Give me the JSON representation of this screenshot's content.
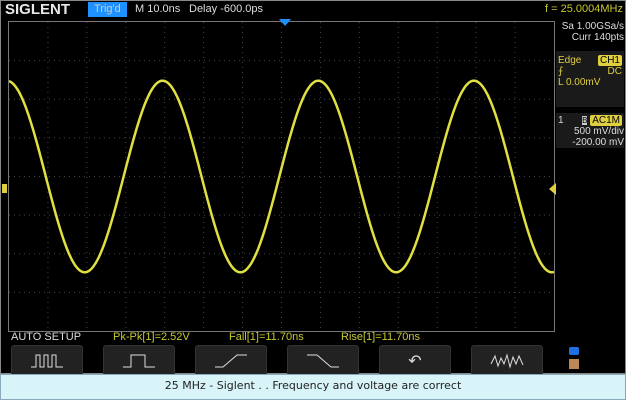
{
  "header": {
    "logo": "SIGLENT",
    "trigger_status": "Trig'd",
    "timebase": "M 10.0ns",
    "delay": "Delay -600.0ps",
    "frequency": "f = 25.0004MHz"
  },
  "acquisition": {
    "sample_rate": "Sa 1.00GSa/s",
    "memory": "Curr 140pts"
  },
  "trigger": {
    "type": "Edge",
    "source": "CH1",
    "coupling": "DC",
    "level": "L  0.00mV"
  },
  "channel": {
    "number": "1",
    "coupling": "AC1M",
    "scale": "500 mV/div",
    "offset": "-200.00 mV"
  },
  "measurements": {
    "auto_setup": "AUTO SETUP",
    "pkpk": "Pk-Pk[1]=2.52V",
    "fall": "Fall[1]=11.70ns",
    "rise": "Rise[1]=11.70ns"
  },
  "buttons": [
    "multi-period",
    "single-period",
    "rising-edge",
    "falling-edge",
    "undo",
    "random"
  ],
  "caption": "25 MHz - Siglent . . Frequency and voltage are correct",
  "waveform": {
    "cycles_on_screen": 3.5,
    "peak_fraction": 0.62,
    "color": "#e0e040",
    "phase_deg": 95
  }
}
